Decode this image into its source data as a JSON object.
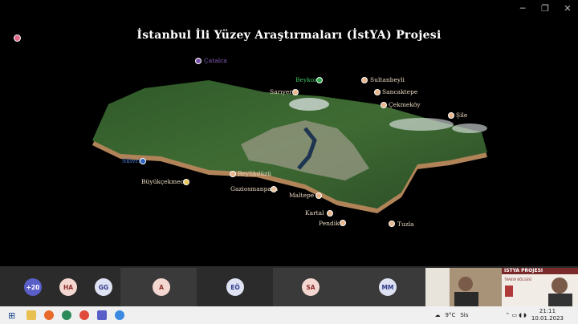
{
  "slide": {
    "title": "İstanbul İli Yüzey Araştırmaları (İstYA) Projesi",
    "labels": [
      {
        "key": "catalca",
        "text": "Çatalca",
        "color": "#7b4fa8"
      },
      {
        "key": "beykoz",
        "text": "Beykoz",
        "color": "#2fa84f"
      },
      {
        "key": "sultanbeyli",
        "text": "Sultanbeyli",
        "color": "#e8b48a"
      },
      {
        "key": "sariyer",
        "text": "Sarıyer",
        "color": "#e8b48a"
      },
      {
        "key": "sancaktepe",
        "text": "Sancaktepe",
        "color": "#e8b48a"
      },
      {
        "key": "cekmekoy",
        "text": "Çekmeköy",
        "color": "#e8b48a"
      },
      {
        "key": "sile",
        "text": "Şile",
        "color": "#e8b48a"
      },
      {
        "key": "silivri",
        "text": "Silivri",
        "color": "#2b5fbf"
      },
      {
        "key": "beylikduzu",
        "text": "Beylikdüzü",
        "color": "#e8b48a"
      },
      {
        "key": "buyukcekmece",
        "text": "Büyükçekmece",
        "color": "#e8c030"
      },
      {
        "key": "gaziosmanpasa",
        "text": "Gaziosmanpaşa",
        "color": "#e8b48a"
      },
      {
        "key": "maltepe",
        "text": "Maltepe",
        "color": "#e8b48a"
      },
      {
        "key": "kartal",
        "text": "Kartal",
        "color": "#e8b48a"
      },
      {
        "key": "pendik",
        "text": "Pendik",
        "color": "#e8b48a"
      },
      {
        "key": "tuzla",
        "text": "Tuzla",
        "color": "#e8b48a"
      }
    ]
  },
  "participants": [
    {
      "initials": "+20",
      "color": "#5a5fc8",
      "text_color": "#fff"
    },
    {
      "initials": "HA",
      "color": "#f3d7d0",
      "text_color": "#8a2e2e"
    },
    {
      "initials": "GG",
      "color": "#dfe2f3",
      "text_color": "#2e3c8a"
    },
    {
      "initials": "A",
      "color": "#f3d7d0",
      "text_color": "#8a2e2e"
    },
    {
      "initials": "EÖ",
      "color": "#dfe2f3",
      "text_color": "#2e3c8a"
    },
    {
      "initials": "SA",
      "color": "#f3d7d0",
      "text_color": "#8a2e2e"
    },
    {
      "initials": "MM",
      "color": "#dfe2f3",
      "text_color": "#2e3c8a"
    }
  ],
  "camera_banner": "İSTYA PROJESİ",
  "camera_sub": "TRAKYA BÖLGESİ",
  "taskbar": {
    "weather_temp": "9°C",
    "weather_desc": "Sis",
    "time": "21:11",
    "date": "10.01.2023"
  }
}
